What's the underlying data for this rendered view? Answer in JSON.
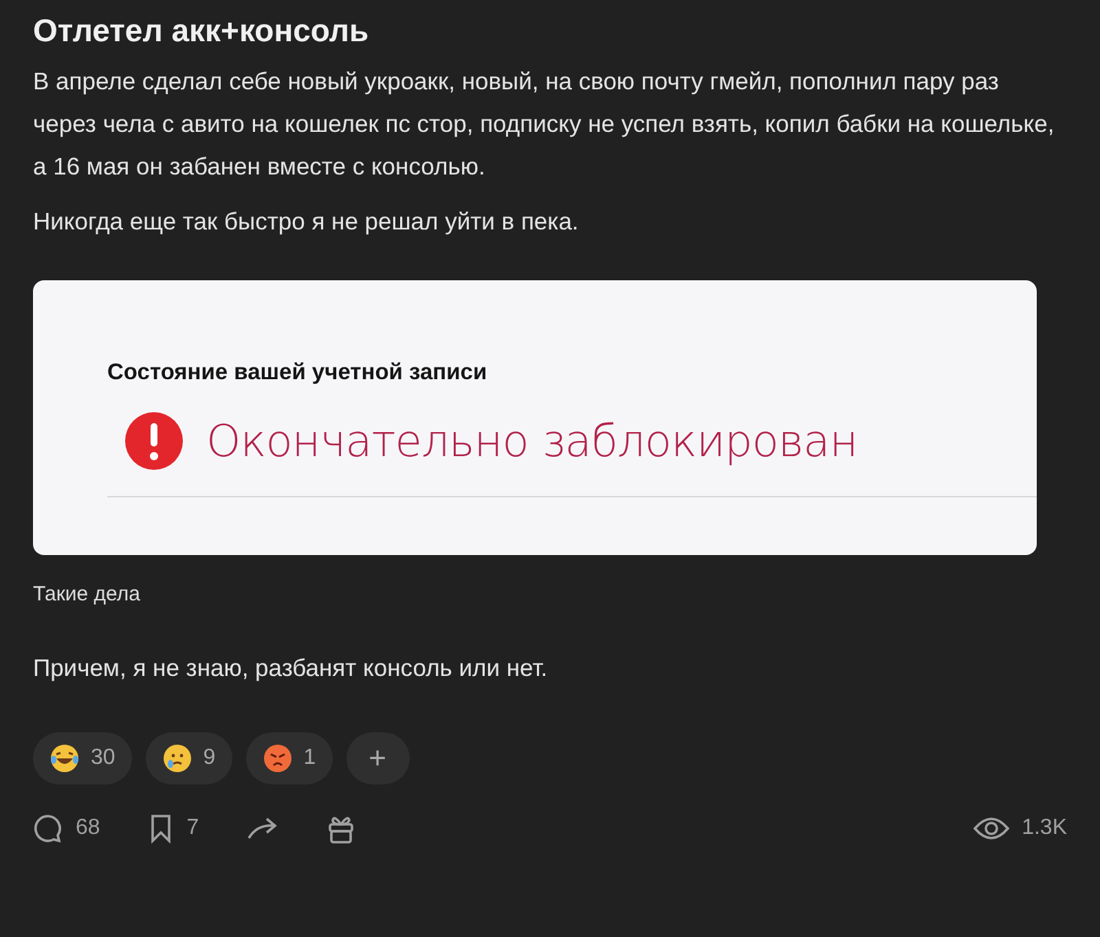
{
  "post": {
    "title": "Отлетел акк+консоль",
    "paragraphs": [
      "В апреле сделал себе новый укроакк, новый, на свою почту гмейл, пополнил пару раз через чела с авито на кошелек пс стор, подписку не успел взять, копил бабки на кошельке, а 16 мая он забанен вместе с консолью.",
      "Никогда еще так быстро я не решал уйти в пека."
    ],
    "screenshot": {
      "heading": "Состояние вашей учетной записи",
      "status": "Окончательно заблокирован"
    },
    "caption": "Такие дела",
    "footer_text": "Причем, я не знаю, разбанят консоль или нет."
  },
  "reactions": [
    {
      "kind": "laugh",
      "count": "30"
    },
    {
      "kind": "tear",
      "count": "9"
    },
    {
      "kind": "angry",
      "count": "1"
    }
  ],
  "add_reaction": "+",
  "stats": {
    "comments": "68",
    "bookmarks": "7",
    "views": "1.3K"
  }
}
